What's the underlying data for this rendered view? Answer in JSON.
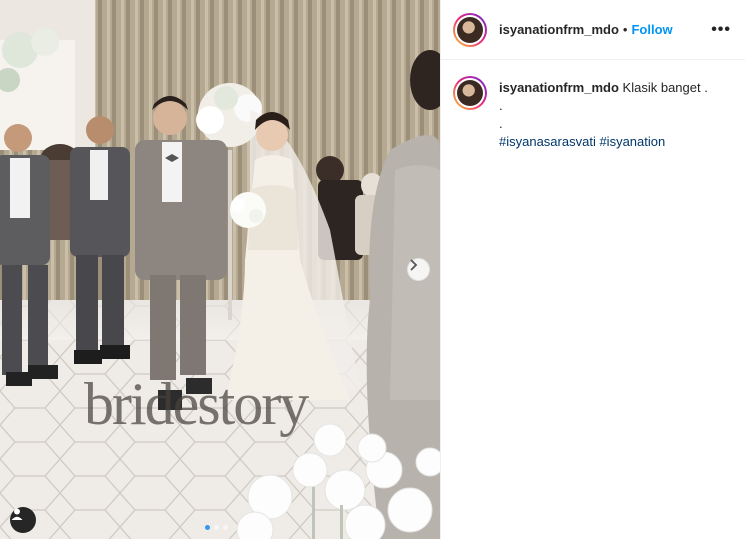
{
  "post": {
    "username": "isyanationfrm_mdo",
    "separator": "•",
    "follow_label": "Follow",
    "more_label": "•••"
  },
  "caption": {
    "username": "isyanationfrm_mdo",
    "text": "Klasik banget .",
    "line2": ".",
    "line3": ".",
    "hashtags": [
      "#isyanasarasvati",
      "#isyanation"
    ]
  },
  "media": {
    "watermark": "bridestory",
    "next_icon": "chevron-right-icon",
    "tag_icon": "user-icon",
    "carousel_count": 3,
    "carousel_active_index": 0
  },
  "colors": {
    "follow": "#0095f6",
    "hashtag": "#00376b",
    "active_dot": "#3897f0"
  }
}
